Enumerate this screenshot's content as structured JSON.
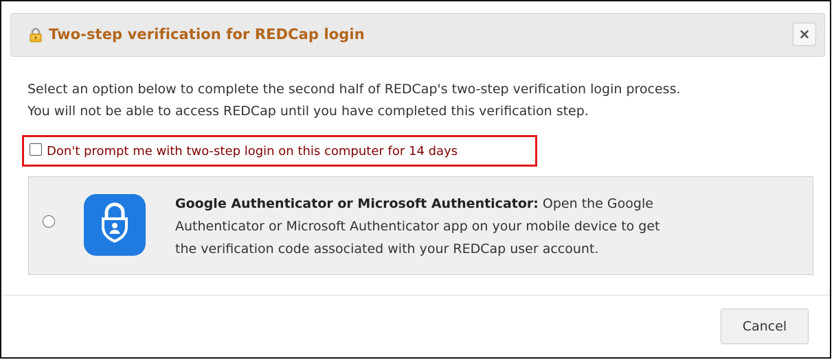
{
  "dialog": {
    "title": "Two-step verification for REDCap login",
    "title_icon": "lock-icon",
    "close_icon": "close-icon"
  },
  "intro": {
    "line1": "Select an option below to complete the second half of REDCap's two-step verification login process.",
    "line2": "You will not be able to access REDCap until you have completed this verification step."
  },
  "remember": {
    "label": "Don't prompt me with two-step login on this computer for 14 days",
    "checked": false
  },
  "options": [
    {
      "icon": "authenticator-app-icon",
      "title": "Google Authenticator or Microsoft Authenticator:",
      "line1_rest": " Open the Google",
      "line2": "Authenticator or Microsoft Authenticator app on your mobile device to get",
      "line3": "the verification code associated with your REDCap user account.",
      "selected": false
    }
  ],
  "footer": {
    "cancel_label": "Cancel"
  },
  "colors": {
    "title": "#b3651b",
    "highlight_border": "#e01818",
    "checkbox_label": "#800000",
    "app_icon_bg": "#1f7be0"
  }
}
